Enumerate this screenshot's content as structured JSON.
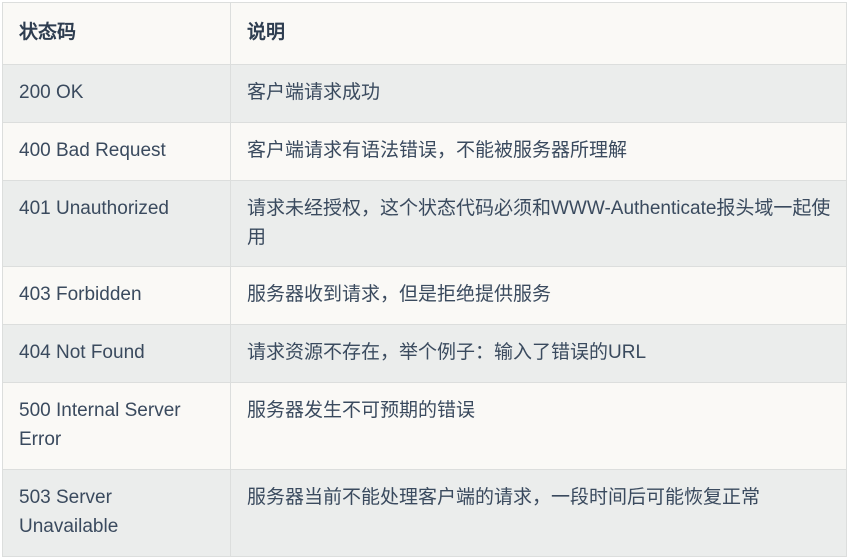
{
  "table": {
    "columns": [
      {
        "key": "code",
        "header": "状态码"
      },
      {
        "key": "description",
        "header": "说明"
      }
    ],
    "rows": [
      {
        "code": "200 OK",
        "description": "客户端请求成功"
      },
      {
        "code": "400 Bad Request",
        "description": "客户端请求有语法错误，不能被服务器所理解"
      },
      {
        "code": "401 Unauthorized",
        "description": "请求未经授权，这个状态代码必须和WWW-Authenticate报头域一起使用"
      },
      {
        "code": "403 Forbidden",
        "description": "服务器收到请求，但是拒绝提供服务"
      },
      {
        "code": "404 Not Found",
        "description": "请求资源不存在，举个例子：输入了错误的URL"
      },
      {
        "code": "500 Internal Server Error",
        "description": "服务器发生不可预期的错误"
      },
      {
        "code": "503 Server Unavailable",
        "description": "服务器当前不能处理客户端的请求，一段时间后可能恢复正常"
      }
    ]
  },
  "colors": {
    "text": "#3a4a5e",
    "header_text": "#2e3d50",
    "row_gray": "#ebedec",
    "row_light": "#faf9f6",
    "border": "#dcdedd"
  }
}
